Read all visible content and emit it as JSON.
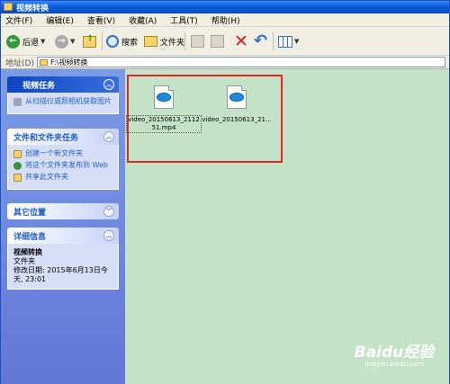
{
  "window": {
    "title": "视频转换"
  },
  "menu": [
    "文件(F)",
    "编辑(E)",
    "查看(V)",
    "收藏(A)",
    "工具(T)",
    "帮助(H)"
  ],
  "toolbar": {
    "back_label": "后退",
    "search_label": "搜索",
    "folders_label": "文件夹"
  },
  "address": {
    "label": "地址(D)",
    "value": "F:\\视频转换"
  },
  "left_pane": {
    "video_tasks": {
      "title": "视频任务",
      "link": "从扫描仪或照相机获取图片"
    },
    "file_tasks": {
      "title": "文件和文件夹任务",
      "links": [
        "创建一个新文件夹",
        "将这个文件夹发布到 Web",
        "共享此文件夹"
      ]
    },
    "other_places": {
      "title": "其它位置"
    },
    "details": {
      "title": "详细信息",
      "name": "视频转换",
      "type": "文件夹",
      "modified": "修改日期: 2015年6月13日今天, 23:01"
    }
  },
  "files": [
    {
      "name": "video_20150613_211251.mp4"
    },
    {
      "name": "video_20150613_21..."
    }
  ],
  "colors": {
    "titlebar": "#0a5fe0",
    "content_bg": "#c4e3c6",
    "highlight_box": "#e0262a"
  },
  "watermark": {
    "logo": "Baidu经验",
    "url": "jingyan.baidu.com"
  }
}
